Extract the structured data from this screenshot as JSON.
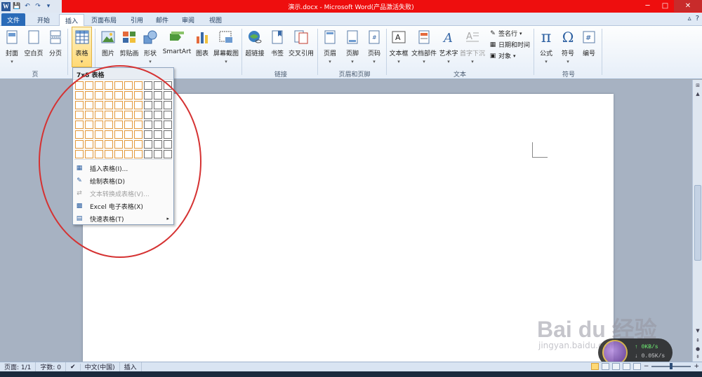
{
  "titlebar": {
    "title": "演示.docx - Microsoft Word(产品激活失败)",
    "app_icon": "W",
    "qat": {
      "save": "save-icon",
      "undo": "undo-icon",
      "redo": "redo-icon",
      "customize": "▾"
    },
    "window_buttons": {
      "minimize": "─",
      "maximize": "□",
      "close": "✕"
    }
  },
  "tabs": {
    "file": "文件",
    "home": "开始",
    "insert": "插入",
    "layout": "页面布局",
    "references": "引用",
    "mailings": "邮件",
    "review": "审阅",
    "view": "视图"
  },
  "ribbon": {
    "pages": {
      "cover": "封面",
      "blank": "空白页",
      "break": "分页",
      "group": "页"
    },
    "tables": {
      "table": "表格"
    },
    "illustrations": {
      "picture": "图片",
      "clipart": "剪贴画",
      "shapes": "形状",
      "smartart": "SmartArt",
      "chart": "图表",
      "screenshot": "屏幕截图"
    },
    "links": {
      "hyperlink": "超链接",
      "bookmark": "书签",
      "crossref": "交叉引用",
      "group": "链接"
    },
    "header_footer": {
      "header": "页眉",
      "footer": "页脚",
      "pagenum": "页码",
      "group": "页眉和页脚"
    },
    "text": {
      "textbox": "文本框",
      "quickparts": "文档部件",
      "wordart": "艺术字",
      "dropcap": "首字下沉",
      "signature": "签名行",
      "datetime": "日期和时间",
      "object": "对象",
      "group": "文本"
    },
    "symbols": {
      "equation": "公式",
      "symbol": "符号",
      "number": "编号",
      "group": "符号"
    }
  },
  "dropdown": {
    "header": "7x8 表格",
    "grid_cols": 10,
    "grid_rows": 8,
    "selected_cols": 7,
    "selected_rows": 8,
    "items": [
      {
        "label": "插入表格(I)...",
        "icon": "insert-table-icon",
        "enabled": true
      },
      {
        "label": "绘制表格(D)",
        "icon": "draw-table-icon",
        "enabled": true
      },
      {
        "label": "文本转换成表格(V)...",
        "icon": "convert-text-icon",
        "enabled": false
      },
      {
        "label": "Excel 电子表格(X)",
        "icon": "excel-icon",
        "enabled": true
      },
      {
        "label": "快速表格(T)",
        "icon": "quick-table-icon",
        "enabled": true,
        "submenu": "▸"
      }
    ]
  },
  "statusbar": {
    "page": "页面: 1/1",
    "words": "字数: 0",
    "language": "中文(中国)",
    "mode": "插入"
  },
  "watermark": {
    "brand": "Bai du 经验",
    "url": "jingyan.baidu.com"
  },
  "netwidget": {
    "up": "↑ 0KB/s",
    "down": "↓ 0.05K/s"
  }
}
